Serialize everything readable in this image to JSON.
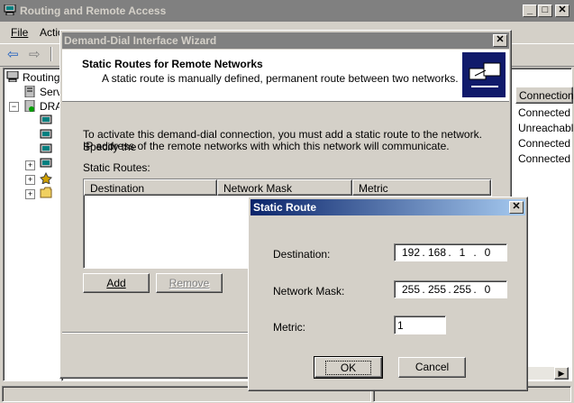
{
  "main_window": {
    "title": "Routing and Remote Access",
    "menu": [
      "File",
      "Actio"
    ],
    "tree": [
      "Routing",
      "Serv",
      "DRA"
    ],
    "column_header": "Connection",
    "status": [
      "Connected",
      "Unreachabl",
      "Connected",
      "Connected"
    ]
  },
  "wizard": {
    "title": "Demand-Dial Interface Wizard",
    "heading": "Static Routes for Remote Networks",
    "subheading": "A static route is manually defined, permanent route between two networks.",
    "body_line1": "To activate this demand-dial connection, you must add a static route to the network. Specify the",
    "body_line2": "IP address of the remote networks with which this network will communicate.",
    "list_label": "Static Routes:",
    "columns": [
      "Destination",
      "Network Mask",
      "Metric"
    ],
    "add_label": "Add",
    "remove_label": "Remove"
  },
  "dialog": {
    "title": "Static Route",
    "destination_label": "Destination:",
    "destination_ip": [
      "192",
      "168",
      "1",
      "0"
    ],
    "mask_label": "Network Mask:",
    "mask_ip": [
      "255",
      "255",
      "255",
      "0"
    ],
    "metric_label": "Metric:",
    "metric_value": "1",
    "ok_label": "OK",
    "cancel_label": "Cancel"
  }
}
